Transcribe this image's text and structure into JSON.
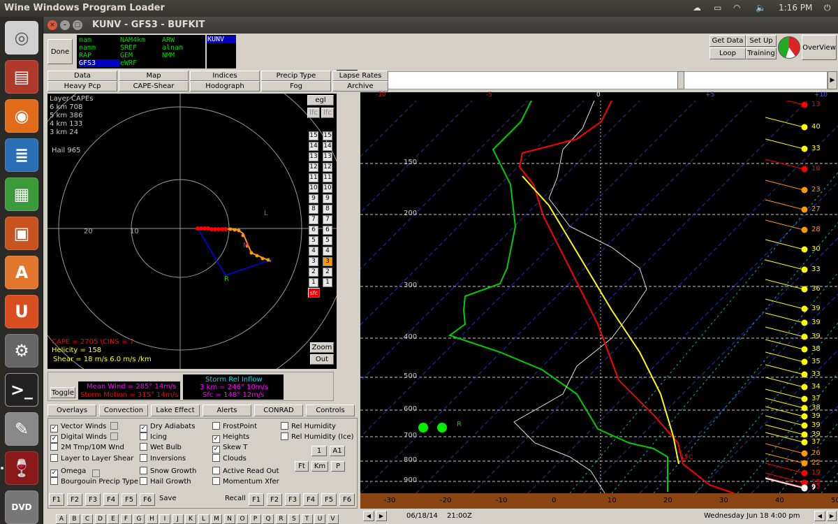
{
  "panel": {
    "title": "Wine Windows Program Loader",
    "clock": "1:16 PM"
  },
  "launcher": {
    "items": [
      "ubuntu-dash-icon",
      "files-icon",
      "firefox-icon",
      "writer-icon",
      "calc-icon",
      "impress-icon",
      "software-center-icon",
      "ubuntu-one-icon",
      "settings-icon",
      "terminal-icon",
      "text-editor-icon",
      "wine-icon",
      "dvd-icon"
    ]
  },
  "window": {
    "title": "KUNV - GFS3 - BUFKIT"
  },
  "toolbar": {
    "done": "Done",
    "models_col1": [
      "nam",
      "namm",
      "RAP",
      "GFS3"
    ],
    "models_col2": [
      "NAM4km",
      "SREF",
      "GEM",
      "eWRF"
    ],
    "models_col3": [
      "ARW",
      "alnam",
      "NMM"
    ],
    "station": "KUNV",
    "get_data": "Get Data",
    "setup": "Set Up",
    "loop": "Loop",
    "training": "Training",
    "overview": "OverView"
  },
  "tabs_row1": [
    "Data",
    "Map",
    "Indices",
    "Precip Type",
    "Lapse Rates"
  ],
  "tabs_row2": [
    "Heavy Pcp",
    "CAPE-Shear",
    "Hodograph",
    "Fog",
    "Archive"
  ],
  "frame_number": "57",
  "hodo": {
    "capes_title": "Layer CAPEs",
    "capes": [
      "6 km  708",
      "5 km  386",
      "4 km  133",
      "3 km  24"
    ],
    "hail": "Hail  965",
    "egl": "egl",
    "lfc1": "lfc",
    "lfc2": "lfc",
    "ring20": "20",
    "ring10": "10",
    "label_L": "L",
    "label_R": "R",
    "label_M": "M",
    "cape": "CAPE = 2705 \\CINS = 7",
    "helicity": "Helicity = 158",
    "shear": "Shear = 18 m/s  6.0 m/s /km",
    "zoom": "Zoom",
    "out": "Out",
    "levels_left": [
      "15",
      "14",
      "13",
      "12",
      "11",
      "10",
      "9",
      "8",
      "7",
      "6",
      "5",
      "4",
      "3",
      "2",
      "1"
    ],
    "levels_right": [
      "15",
      "14",
      "13",
      "12",
      "11",
      "10",
      "9",
      "8",
      "7",
      "6",
      "5",
      "4",
      "3",
      "2",
      "1"
    ],
    "sfc": "sfc"
  },
  "toggle": "Toggle",
  "mean_wind": "Mean Wind = 285°  14m/s",
  "storm_motion": "Storm Motion = 315°  14m/s",
  "srel_title": "Storm Rel Inflow",
  "srel_3km": "3 km = 246°  10m/s",
  "srel_sfc": "Sfc = 148°  12m/s",
  "lower_tabs": [
    "Overlays",
    "Convection",
    "Lake Effect",
    "Alerts",
    "CONRAD",
    "Controls"
  ],
  "checks": [
    {
      "label": "Vector Winds",
      "checked": true
    },
    {
      "label": "Digital Winds",
      "checked": true
    },
    {
      "label": "2M Tmp/10M Wnd",
      "checked": false
    },
    {
      "label": "Layer to Layer Shear",
      "checked": false
    },
    {
      "label": "Omega",
      "checked": true
    },
    {
      "label": "Bourgouin Precip Type",
      "checked": false
    },
    {
      "label": "Dry Adiabats",
      "checked": true
    },
    {
      "label": "Icing",
      "checked": false
    },
    {
      "label": "Wet Bulb",
      "checked": false
    },
    {
      "label": "Inversions",
      "checked": false
    },
    {
      "label": "Snow Growth",
      "checked": false
    },
    {
      "label": "Hail Growth",
      "checked": false
    },
    {
      "label": "FrostPoint",
      "checked": false
    },
    {
      "label": "Heights",
      "checked": true
    },
    {
      "label": "Skew T",
      "checked": true
    },
    {
      "label": "Clouds",
      "checked": false
    },
    {
      "label": "Active Read Out",
      "checked": false
    },
    {
      "label": "Momentum Xfer",
      "checked": false
    },
    {
      "label": "Rel Humidity",
      "checked": false
    },
    {
      "label": "Rel Humidity (Ice)",
      "checked": false
    }
  ],
  "small_btns": {
    "one": "1",
    "a1": "A1",
    "ft": "Ft",
    "km": "Km",
    "p": "P"
  },
  "fkeys_save": [
    "F1",
    "F2",
    "F3",
    "F4",
    "F5",
    "F6"
  ],
  "save": "Save",
  "recall": "Recall",
  "fkeys_recall": [
    "F1",
    "F2",
    "F3",
    "F4",
    "F5",
    "F6"
  ],
  "letters": [
    "A",
    "B",
    "C",
    "D",
    "E",
    "F",
    "G",
    "H",
    "I",
    "J",
    "K",
    "L",
    "M",
    "N",
    "O",
    "P",
    "Q",
    "R",
    "S",
    "T",
    "U",
    "V"
  ],
  "skewt": {
    "scale_labels": [
      "-10",
      "-5",
      "0",
      "+5",
      "+10"
    ],
    "pressure_labels": [
      "150",
      "200",
      "300",
      "400",
      "500",
      "600",
      "700",
      "800",
      "900"
    ],
    "temp_labels": [
      "-30",
      "-20",
      "-10",
      "0",
      "10",
      "20",
      "30",
      "40",
      "50"
    ],
    "wind_speeds": [
      "13",
      "40",
      "33",
      "18",
      "23",
      "27",
      "28",
      "30",
      "33",
      "36",
      "39",
      "39",
      "39",
      "38",
      "35",
      "33",
      "34",
      "37",
      "38",
      "39",
      "39",
      "39",
      "37",
      "26",
      "22",
      "19",
      "15",
      "13",
      "9",
      "7"
    ],
    "lfc_label": "LFC",
    "r_label": "R",
    "date": "06/18/14",
    "time": "21:00Z",
    "valid": "Wednesday   Jun 18  4:00 pm"
  }
}
